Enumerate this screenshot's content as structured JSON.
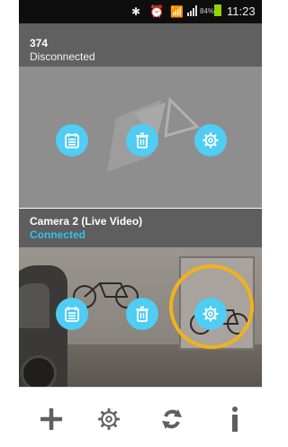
{
  "status_bar": {
    "bluetooth_icon": "bluetooth-icon",
    "alarm_icon": "alarm-icon",
    "wifi_icon": "wifi-icon",
    "signal_icon": "signal-icon",
    "battery_percent": "84%",
    "time": "11:23"
  },
  "cameras": [
    {
      "name": "374",
      "state": "Disconnected",
      "state_color": "#f2f2f2"
    },
    {
      "name": "Camera 2 (Live Video)",
      "state": "Connected",
      "state_color": "#2fc4ee"
    }
  ],
  "actions": [
    "calendar-icon",
    "trash-icon",
    "settings-icon"
  ],
  "toolbar": [
    "add-icon",
    "settings-icon",
    "refresh-icon",
    "info-icon"
  ],
  "colors": {
    "accent": "#4fcdf2",
    "highlight": "#f1b21c",
    "toolbar_icon": "#5f5f5f"
  }
}
